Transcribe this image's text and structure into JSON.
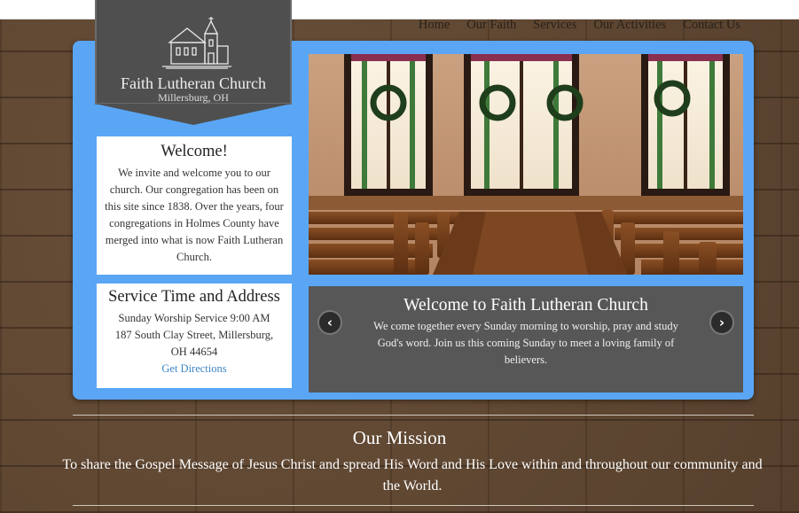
{
  "site": {
    "name": "Faith Lutheran Church",
    "location": "Millersburg, OH"
  },
  "nav": {
    "items": [
      "Home",
      "Our Faith",
      "Services",
      "Our Activities",
      "Contact Us"
    ]
  },
  "welcome": {
    "title": "Welcome!",
    "text": "We invite and welcome you to our church. Our congregation has been on this site since 1838. Over the years, four congregations in Holmes County have merged into what is now Faith Lutheran Church."
  },
  "service": {
    "title": "Service Time and Address",
    "time": "Sunday Worship Service 9:00 AM",
    "address": "187 South Clay Street, Millersburg, OH 44654",
    "directions_label": "Get Directions"
  },
  "slider": {
    "title": "Welcome to Faith Lutheran Church",
    "text": "We come together every Sunday morning to worship, pray and study God's word. Join us this coming Sunday to meet a loving family of believers.",
    "prev_icon": "chevron-left-icon",
    "next_icon": "chevron-right-icon"
  },
  "mission": {
    "title": "Our Mission",
    "text": "To share the Gospel Message of Jesus Christ and spread His Word and His Love within and throughout our community and the World."
  },
  "colors": {
    "panel": "#5aa6f5",
    "banner": "#4f4f4f",
    "caption": "#575757",
    "link": "#3d86c6",
    "brick": "#5f4733"
  }
}
